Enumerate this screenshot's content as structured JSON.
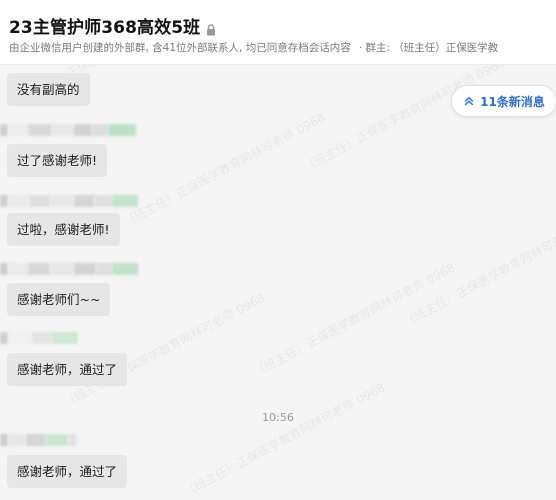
{
  "header": {
    "title": "23主管护师368高效5班",
    "subtitle_main": "由企业微信用户创建的外部群, 含41位外部联系人, 均已同意存档会话内容",
    "subtitle_owner": "· 群主: （班主任）正保医学教"
  },
  "new_messages_button": {
    "label": "11条新消息"
  },
  "watermark_text": "（班主任）正保医学教育网林可老师 0968",
  "messages": [
    {
      "text": "没有副高的"
    },
    {
      "text": "过了感谢老师!"
    },
    {
      "text": "过啦，感谢老师!"
    },
    {
      "text": "感谢老师们~~"
    },
    {
      "text": "感谢老师，通过了"
    },
    {
      "text": "感谢老师，通过了"
    }
  ],
  "time_divider": "10:56",
  "colors": {
    "accent": "#2b6fd6",
    "bubble": "#e6e6e6",
    "background": "#f5f5f5"
  }
}
